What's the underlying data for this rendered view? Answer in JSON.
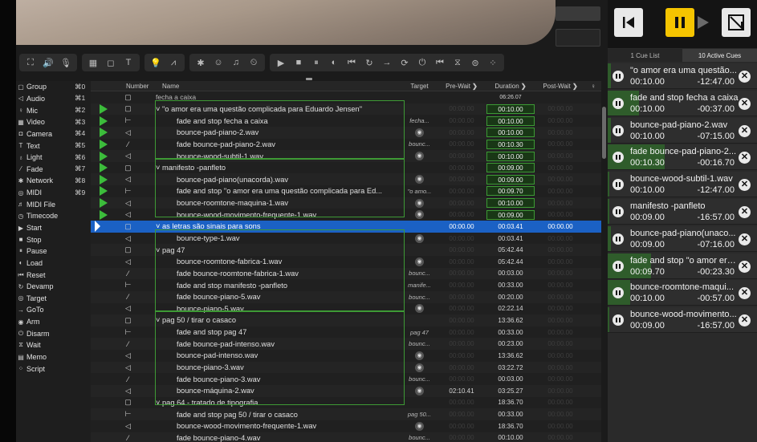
{
  "toolbar_groups": [
    [
      "⛶",
      "🔊",
      "🎙"
    ],
    [
      "▦",
      "◻",
      "T"
    ],
    [
      "💡",
      "⩘"
    ],
    [
      "✱",
      "☺",
      "♫",
      "⏲"
    ],
    [
      "▶",
      "■",
      "⏸",
      "◐",
      "⏮",
      "↻",
      "→",
      "⟳",
      "⏻",
      "⏮",
      "⧖",
      "⊜",
      "⁘"
    ]
  ],
  "sidebar": [
    {
      "icon": "▢",
      "label": "Group",
      "key": "⌘0"
    },
    {
      "icon": "◁",
      "label": "Audio",
      "key": "⌘1"
    },
    {
      "icon": "♀",
      "label": "Mic",
      "key": "⌘2"
    },
    {
      "icon": "▦",
      "label": "Video",
      "key": "⌘3"
    },
    {
      "icon": "◘",
      "label": "Camera",
      "key": "⌘4"
    },
    {
      "icon": "T",
      "label": "Text",
      "key": "⌘5"
    },
    {
      "icon": "♁",
      "label": "Light",
      "key": "⌘6"
    },
    {
      "icon": "⁄",
      "label": "Fade",
      "key": "⌘7"
    },
    {
      "icon": "✱",
      "label": "Network",
      "key": "⌘8"
    },
    {
      "icon": "◎",
      "label": "MIDI",
      "key": "⌘9"
    },
    {
      "icon": "♬",
      "label": "MIDI File",
      "key": ""
    },
    {
      "icon": "◷",
      "label": "Timecode",
      "key": ""
    },
    {
      "icon": "▶",
      "label": "Start",
      "key": ""
    },
    {
      "icon": "■",
      "label": "Stop",
      "key": ""
    },
    {
      "icon": "⏸",
      "label": "Pause",
      "key": ""
    },
    {
      "icon": "◐",
      "label": "Load",
      "key": ""
    },
    {
      "icon": "⏮",
      "label": "Reset",
      "key": ""
    },
    {
      "icon": "↻",
      "label": "Devamp",
      "key": ""
    },
    {
      "icon": "◎",
      "label": "Target",
      "key": ""
    },
    {
      "icon": "→",
      "label": "GoTo",
      "key": ""
    },
    {
      "icon": "◉",
      "label": "Arm",
      "key": ""
    },
    {
      "icon": "⏻",
      "label": "Disarm",
      "key": ""
    },
    {
      "icon": "⧖",
      "label": "Wait",
      "key": ""
    },
    {
      "icon": "▤",
      "label": "Memo",
      "key": ""
    },
    {
      "icon": "⁘",
      "label": "Script",
      "key": ""
    }
  ],
  "headers": {
    "number": "Number",
    "name": "Name",
    "target": "Target",
    "prewait": "Pre-Wait",
    "duration": "Duration",
    "postwait": "Post-Wait"
  },
  "rows": [
    {
      "play": false,
      "type": "▢",
      "indent": 1,
      "name": "fecha a caixa",
      "target": "",
      "tc": false,
      "pre": "",
      "dur": "06:26.07",
      "dbox": false,
      "post": "",
      "sel": false,
      "dim": true
    },
    {
      "play": true,
      "type": "▢",
      "indent": 1,
      "name": "˅ \"o amor era uma questão complicada para Eduardo Jensen\"",
      "target": "",
      "tc": false,
      "pre": "00:00.00",
      "dur": "00:10.00",
      "dbox": true,
      "post": "00:00.00",
      "sel": false
    },
    {
      "play": true,
      "type": "⊢",
      "indent": 2,
      "name": "fade and stop fecha a caixa",
      "target": "fecha...",
      "tc": false,
      "pre": "00:00.00",
      "dur": "00:10.00",
      "dbox": true,
      "post": "00:00.00",
      "sel": false
    },
    {
      "play": true,
      "type": "◁",
      "indent": 2,
      "name": "bounce-pad-piano-2.wav",
      "target": "",
      "tc": true,
      "pre": "00:00.00",
      "dur": "00:10.00",
      "dbox": true,
      "post": "00:00.00",
      "sel": false
    },
    {
      "play": true,
      "type": "⁄",
      "indent": 2,
      "name": "fade bounce-pad-piano-2.wav",
      "target": "bounc...",
      "tc": false,
      "pre": "00:00.00",
      "dur": "00:10.30",
      "dbox": true,
      "post": "00:00.00",
      "sel": false
    },
    {
      "play": true,
      "type": "◁",
      "indent": 2,
      "name": "bounce-wood-subtil-1.wav",
      "target": "",
      "tc": true,
      "pre": "00:00.00",
      "dur": "00:10.00",
      "dbox": true,
      "post": "00:00.00",
      "sel": false
    },
    {
      "play": true,
      "type": "▢",
      "indent": 1,
      "name": "˅ manifesto -panfleto",
      "target": "",
      "tc": false,
      "pre": "00:00.00",
      "dur": "00:09.00",
      "dbox": true,
      "post": "00:00.00",
      "sel": false
    },
    {
      "play": true,
      "type": "◁",
      "indent": 2,
      "name": "bounce-pad-piano(unacorda).wav",
      "target": "",
      "tc": true,
      "pre": "00:00.00",
      "dur": "00:09.00",
      "dbox": true,
      "post": "00:00.00",
      "sel": false
    },
    {
      "play": true,
      "type": "⊢",
      "indent": 2,
      "name": "fade and stop \"o amor era uma questão complicada para Ed...",
      "target": "\"o amo...",
      "tc": false,
      "pre": "00:00.00",
      "dur": "00:09.70",
      "dbox": true,
      "post": "00:00.00",
      "sel": false
    },
    {
      "play": true,
      "type": "◁",
      "indent": 2,
      "name": "bounce-roomtone-maquina-1.wav",
      "target": "",
      "tc": true,
      "pre": "00:00.00",
      "dur": "00:10.00",
      "dbox": true,
      "post": "00:00.00",
      "sel": false
    },
    {
      "play": true,
      "type": "◁",
      "indent": 2,
      "name": "bounce-wood-movimento-frequente-1.wav",
      "target": "",
      "tc": true,
      "pre": "00:00.00",
      "dur": "00:09.00",
      "dbox": true,
      "post": "00:00.00",
      "sel": false
    },
    {
      "play": false,
      "type": "▢",
      "indent": 1,
      "name": "˅ as letras são sinais para sons",
      "target": "",
      "tc": false,
      "pre": "00:00.00",
      "dur": "00:03.41",
      "dbox": false,
      "post": "00:00.00",
      "sel": true
    },
    {
      "play": false,
      "type": "◁",
      "indent": 2,
      "name": "bounce-type-1.wav",
      "target": "",
      "tc": true,
      "pre": "00:00.00",
      "dur": "00:03.41",
      "dbox": false,
      "post": "00:00.00",
      "sel": false
    },
    {
      "play": false,
      "type": "▢",
      "indent": 1,
      "name": "˅ pag 47",
      "target": "",
      "tc": false,
      "pre": "00:00.00",
      "dur": "05:42.44",
      "dbox": false,
      "post": "00:00.00",
      "sel": false
    },
    {
      "play": false,
      "type": "◁",
      "indent": 2,
      "name": "bounce-roomtone-fabrica-1.wav",
      "target": "",
      "tc": true,
      "pre": "00:00.00",
      "dur": "05:42.44",
      "dbox": false,
      "post": "00:00.00",
      "sel": false
    },
    {
      "play": false,
      "type": "⁄",
      "indent": 2,
      "name": "fade bounce-roomtone-fabrica-1.wav",
      "target": "bounc...",
      "tc": false,
      "pre": "00:00.00",
      "dur": "00:03.00",
      "dbox": false,
      "post": "00:00.00",
      "sel": false
    },
    {
      "play": false,
      "type": "⊢",
      "indent": 2,
      "name": "fade and stop manifesto -panfleto",
      "target": "manife...",
      "tc": false,
      "pre": "00:00.00",
      "dur": "00:33.00",
      "dbox": false,
      "post": "00:00.00",
      "sel": false
    },
    {
      "play": false,
      "type": "⁄",
      "indent": 2,
      "name": "fade bounce-piano-5.wav",
      "target": "bounc...",
      "tc": false,
      "pre": "00:00.00",
      "dur": "00:20.00",
      "dbox": false,
      "post": "00:00.00",
      "sel": false
    },
    {
      "play": false,
      "type": "◁",
      "indent": 2,
      "name": "bounce-piano-5.wav",
      "target": "",
      "tc": true,
      "pre": "00:00.00",
      "dur": "02:22.14",
      "dbox": false,
      "post": "00:00.00",
      "sel": false
    },
    {
      "play": false,
      "type": "▢",
      "indent": 1,
      "name": "˅ pag 50 / tirar o casaco",
      "target": "",
      "tc": false,
      "pre": "00:00.00",
      "dur": "13:36.62",
      "dbox": false,
      "post": "00:00.00",
      "sel": false
    },
    {
      "play": false,
      "type": "⊢",
      "indent": 2,
      "name": "fade and stop pag 47",
      "target": "pag 47",
      "tc": false,
      "pre": "00:00.00",
      "dur": "00:33.00",
      "dbox": false,
      "post": "00:00.00",
      "sel": false
    },
    {
      "play": false,
      "type": "⁄",
      "indent": 2,
      "name": "fade bounce-pad-intenso.wav",
      "target": "bounc...",
      "tc": false,
      "pre": "00:00.00",
      "dur": "00:23.00",
      "dbox": false,
      "post": "00:00.00",
      "sel": false
    },
    {
      "play": false,
      "type": "◁",
      "indent": 2,
      "name": "bounce-pad-intenso.wav",
      "target": "",
      "tc": true,
      "pre": "00:00.00",
      "dur": "13:36.62",
      "dbox": false,
      "post": "00:00.00",
      "sel": false
    },
    {
      "play": false,
      "type": "◁",
      "indent": 2,
      "name": "bounce-piano-3.wav",
      "target": "",
      "tc": true,
      "pre": "00:00.00",
      "dur": "03:22.72",
      "dbox": false,
      "post": "00:00.00",
      "sel": false
    },
    {
      "play": false,
      "type": "⁄",
      "indent": 2,
      "name": "fade bounce-piano-3.wav",
      "target": "bounc...",
      "tc": false,
      "pre": "00:00.00",
      "dur": "00:03.00",
      "dbox": false,
      "post": "00:00.00",
      "sel": false
    },
    {
      "play": false,
      "type": "◁",
      "indent": 2,
      "name": "bounce-máquina-2.wav",
      "target": "",
      "tc": true,
      "pre": "02:10.41",
      "dur": "03:25.27",
      "dbox": false,
      "post": "00:00.00",
      "sel": false,
      "preon": true
    },
    {
      "play": false,
      "type": "▢",
      "indent": 1,
      "name": "˅ pag 64 - tratado de tipografia",
      "target": "",
      "tc": false,
      "pre": "00:00.00",
      "dur": "18:36.70",
      "dbox": false,
      "post": "00:00.00",
      "sel": false
    },
    {
      "play": false,
      "type": "⊢",
      "indent": 2,
      "name": "fade and stop pag 50 / tirar o casaco",
      "target": "pag 50...",
      "tc": false,
      "pre": "00:00.00",
      "dur": "00:33.00",
      "dbox": false,
      "post": "00:00.00",
      "sel": false
    },
    {
      "play": false,
      "type": "◁",
      "indent": 2,
      "name": "bounce-wood-movimento-frequente-1.wav",
      "target": "",
      "tc": true,
      "pre": "00:00.00",
      "dur": "18:36.70",
      "dbox": false,
      "post": "00:00.00",
      "sel": false
    },
    {
      "play": false,
      "type": "⁄",
      "indent": 2,
      "name": "fade bounce-piano-4.wav",
      "target": "bounc...",
      "tc": false,
      "pre": "00:00.00",
      "dur": "00:10.00",
      "dbox": false,
      "post": "00:00.00",
      "sel": false
    }
  ],
  "tabs": {
    "cue_list": "1 Cue List",
    "active": "10 Active Cues"
  },
  "active_cues": [
    {
      "name": "\"o amor era uma questão...",
      "elapsed": "00:10.00",
      "remain": "-12:47.00",
      "progress": 0.02
    },
    {
      "name": "fade and stop fecha a caixa",
      "elapsed": "00:10.00",
      "remain": "-00:37.00",
      "progress": 0.21
    },
    {
      "name": "bounce-pad-piano-2.wav",
      "elapsed": "00:10.00",
      "remain": "-07:15.00",
      "progress": 0.02
    },
    {
      "name": "fade bounce-pad-piano-2...",
      "elapsed": "00:10.30",
      "remain": "-00:16.70",
      "progress": 0.38
    },
    {
      "name": "bounce-wood-subtil-1.wav",
      "elapsed": "00:10.00",
      "remain": "-12:47.00",
      "progress": 0.01
    },
    {
      "name": "manifesto -panfleto",
      "elapsed": "00:09.00",
      "remain": "-16:57.00",
      "progress": 0.01
    },
    {
      "name": "bounce-pad-piano(unaco...",
      "elapsed": "00:09.00",
      "remain": "-07:16.00",
      "progress": 0.02
    },
    {
      "name": "fade and stop \"o amor era...",
      "elapsed": "00:09.70",
      "remain": "-00:23.30",
      "progress": 0.29
    },
    {
      "name": "bounce-roomtone-maqui...",
      "elapsed": "00:10.00",
      "remain": "-00:57.00",
      "progress": 0.15
    },
    {
      "name": "bounce-wood-movimento...",
      "elapsed": "00:09.00",
      "remain": "-16:57.00",
      "progress": 0.01
    }
  ],
  "colors": {
    "green": "#3cbc3b",
    "select": "#1b61c4",
    "transport_pause": "#f5c400"
  }
}
